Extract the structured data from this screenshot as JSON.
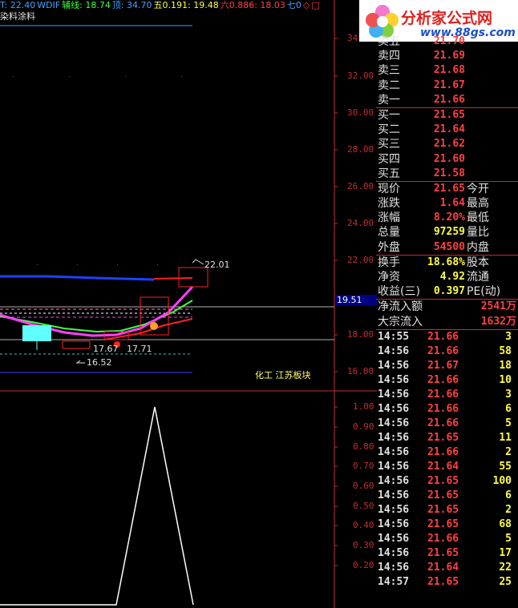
{
  "topbar": {
    "items": [
      {
        "text": "T: 22.40",
        "color": "#40a0ff"
      },
      {
        "text": "WDIF",
        "color": "#40a0ff"
      },
      {
        "text": "辅线: 18.74",
        "color": "#40ff40"
      },
      {
        "text": "顶: 34.70",
        "color": "#40a0ff"
      },
      {
        "text": "五0.191: 19.48",
        "color": "#ffff40"
      },
      {
        "text": "六0.886: 18.03",
        "color": "#ff4040"
      },
      {
        "text": "七0",
        "color": "#40a0ff"
      }
    ],
    "subtitle": "染料涂料"
  },
  "price_axis": [
    "34",
    "32.00",
    "30.00",
    "28.00",
    "26.00",
    "24.00",
    "22.00",
    "18.00",
    "16.00"
  ],
  "current_price_tag": "19.51",
  "indicator_axis": [
    "1.00",
    "0.90",
    "0.80",
    "0.70",
    "0.60",
    "0.50",
    "0.40",
    "0.30",
    "0.20"
  ],
  "annotations": {
    "high": "22.01",
    "low": "16.52",
    "low2": "17.67",
    "low3": "17.71",
    "sector": "化工 江苏板块"
  },
  "logo": {
    "title": "分析家公式网",
    "url": "www.88gs.com"
  },
  "orderbook": {
    "sell": [
      {
        "label": "卖五",
        "price": "21.70"
      },
      {
        "label": "卖四",
        "price": "21.69"
      },
      {
        "label": "卖三",
        "price": "21.68"
      },
      {
        "label": "卖二",
        "price": "21.67"
      },
      {
        "label": "卖一",
        "price": "21.66"
      }
    ],
    "buy": [
      {
        "label": "买一",
        "price": "21.65"
      },
      {
        "label": "买二",
        "price": "21.64"
      },
      {
        "label": "买三",
        "price": "21.62"
      },
      {
        "label": "买四",
        "price": "21.60"
      },
      {
        "label": "买五",
        "price": "21.58"
      }
    ]
  },
  "quote": [
    {
      "label": "现价",
      "value": "21.65",
      "label2": "今开"
    },
    {
      "label": "涨跌",
      "value": "1.64",
      "label2": "最高"
    },
    {
      "label": "涨幅",
      "value": "8.20%",
      "label2": "最低"
    },
    {
      "label": "总量",
      "value": "97259",
      "label2": "量比"
    },
    {
      "label": "外盘",
      "value": "54500",
      "label2": "内盘"
    }
  ],
  "fundamentals": [
    {
      "label": "换手",
      "value": "18.68%",
      "label2": "股本"
    },
    {
      "label": "净资",
      "value": "4.92",
      "label2": "流通"
    },
    {
      "label": "收益(三)",
      "value": "0.397",
      "label2": "PE(动)"
    }
  ],
  "flows": [
    {
      "label": "净流入额",
      "value": "2541万"
    },
    {
      "label": "大宗流入",
      "value": "1632万"
    }
  ],
  "ticks": [
    {
      "time": "14:55",
      "price": "21.66",
      "vol": "3",
      "color": "#ff4040"
    },
    {
      "time": "14:56",
      "price": "21.66",
      "vol": "58",
      "color": "#ff4040"
    },
    {
      "time": "14:56",
      "price": "21.67",
      "vol": "18",
      "color": "#ff4040"
    },
    {
      "time": "14:56",
      "price": "21.66",
      "vol": "10",
      "color": "#ff4040"
    },
    {
      "time": "14:56",
      "price": "21.66",
      "vol": "3",
      "color": "#ff4040"
    },
    {
      "time": "14:56",
      "price": "21.66",
      "vol": "6",
      "color": "#ff4040"
    },
    {
      "time": "14:56",
      "price": "21.66",
      "vol": "5",
      "color": "#ff4040"
    },
    {
      "time": "14:56",
      "price": "21.65",
      "vol": "11",
      "color": "#ff4040"
    },
    {
      "time": "14:56",
      "price": "21.66",
      "vol": "2",
      "color": "#ff4040"
    },
    {
      "time": "14:56",
      "price": "21.64",
      "vol": "55",
      "color": "#ff4040"
    },
    {
      "time": "14:56",
      "price": "21.65",
      "vol": "100",
      "color": "#ff4040"
    },
    {
      "time": "14:56",
      "price": "21.65",
      "vol": "6",
      "color": "#ff4040"
    },
    {
      "time": "14:56",
      "price": "21.65",
      "vol": "2",
      "color": "#ff4040"
    },
    {
      "time": "14:56",
      "price": "21.65",
      "vol": "68",
      "color": "#ff4040"
    },
    {
      "time": "14:56",
      "price": "21.66",
      "vol": "5",
      "color": "#ff4040"
    },
    {
      "time": "14:56",
      "price": "21.65",
      "vol": "17",
      "color": "#ff4040"
    },
    {
      "time": "14:56",
      "price": "21.64",
      "vol": "22",
      "color": "#ff4040"
    },
    {
      "time": "14:57",
      "price": "21.65",
      "vol": "25",
      "color": "#ff4040"
    }
  ]
}
